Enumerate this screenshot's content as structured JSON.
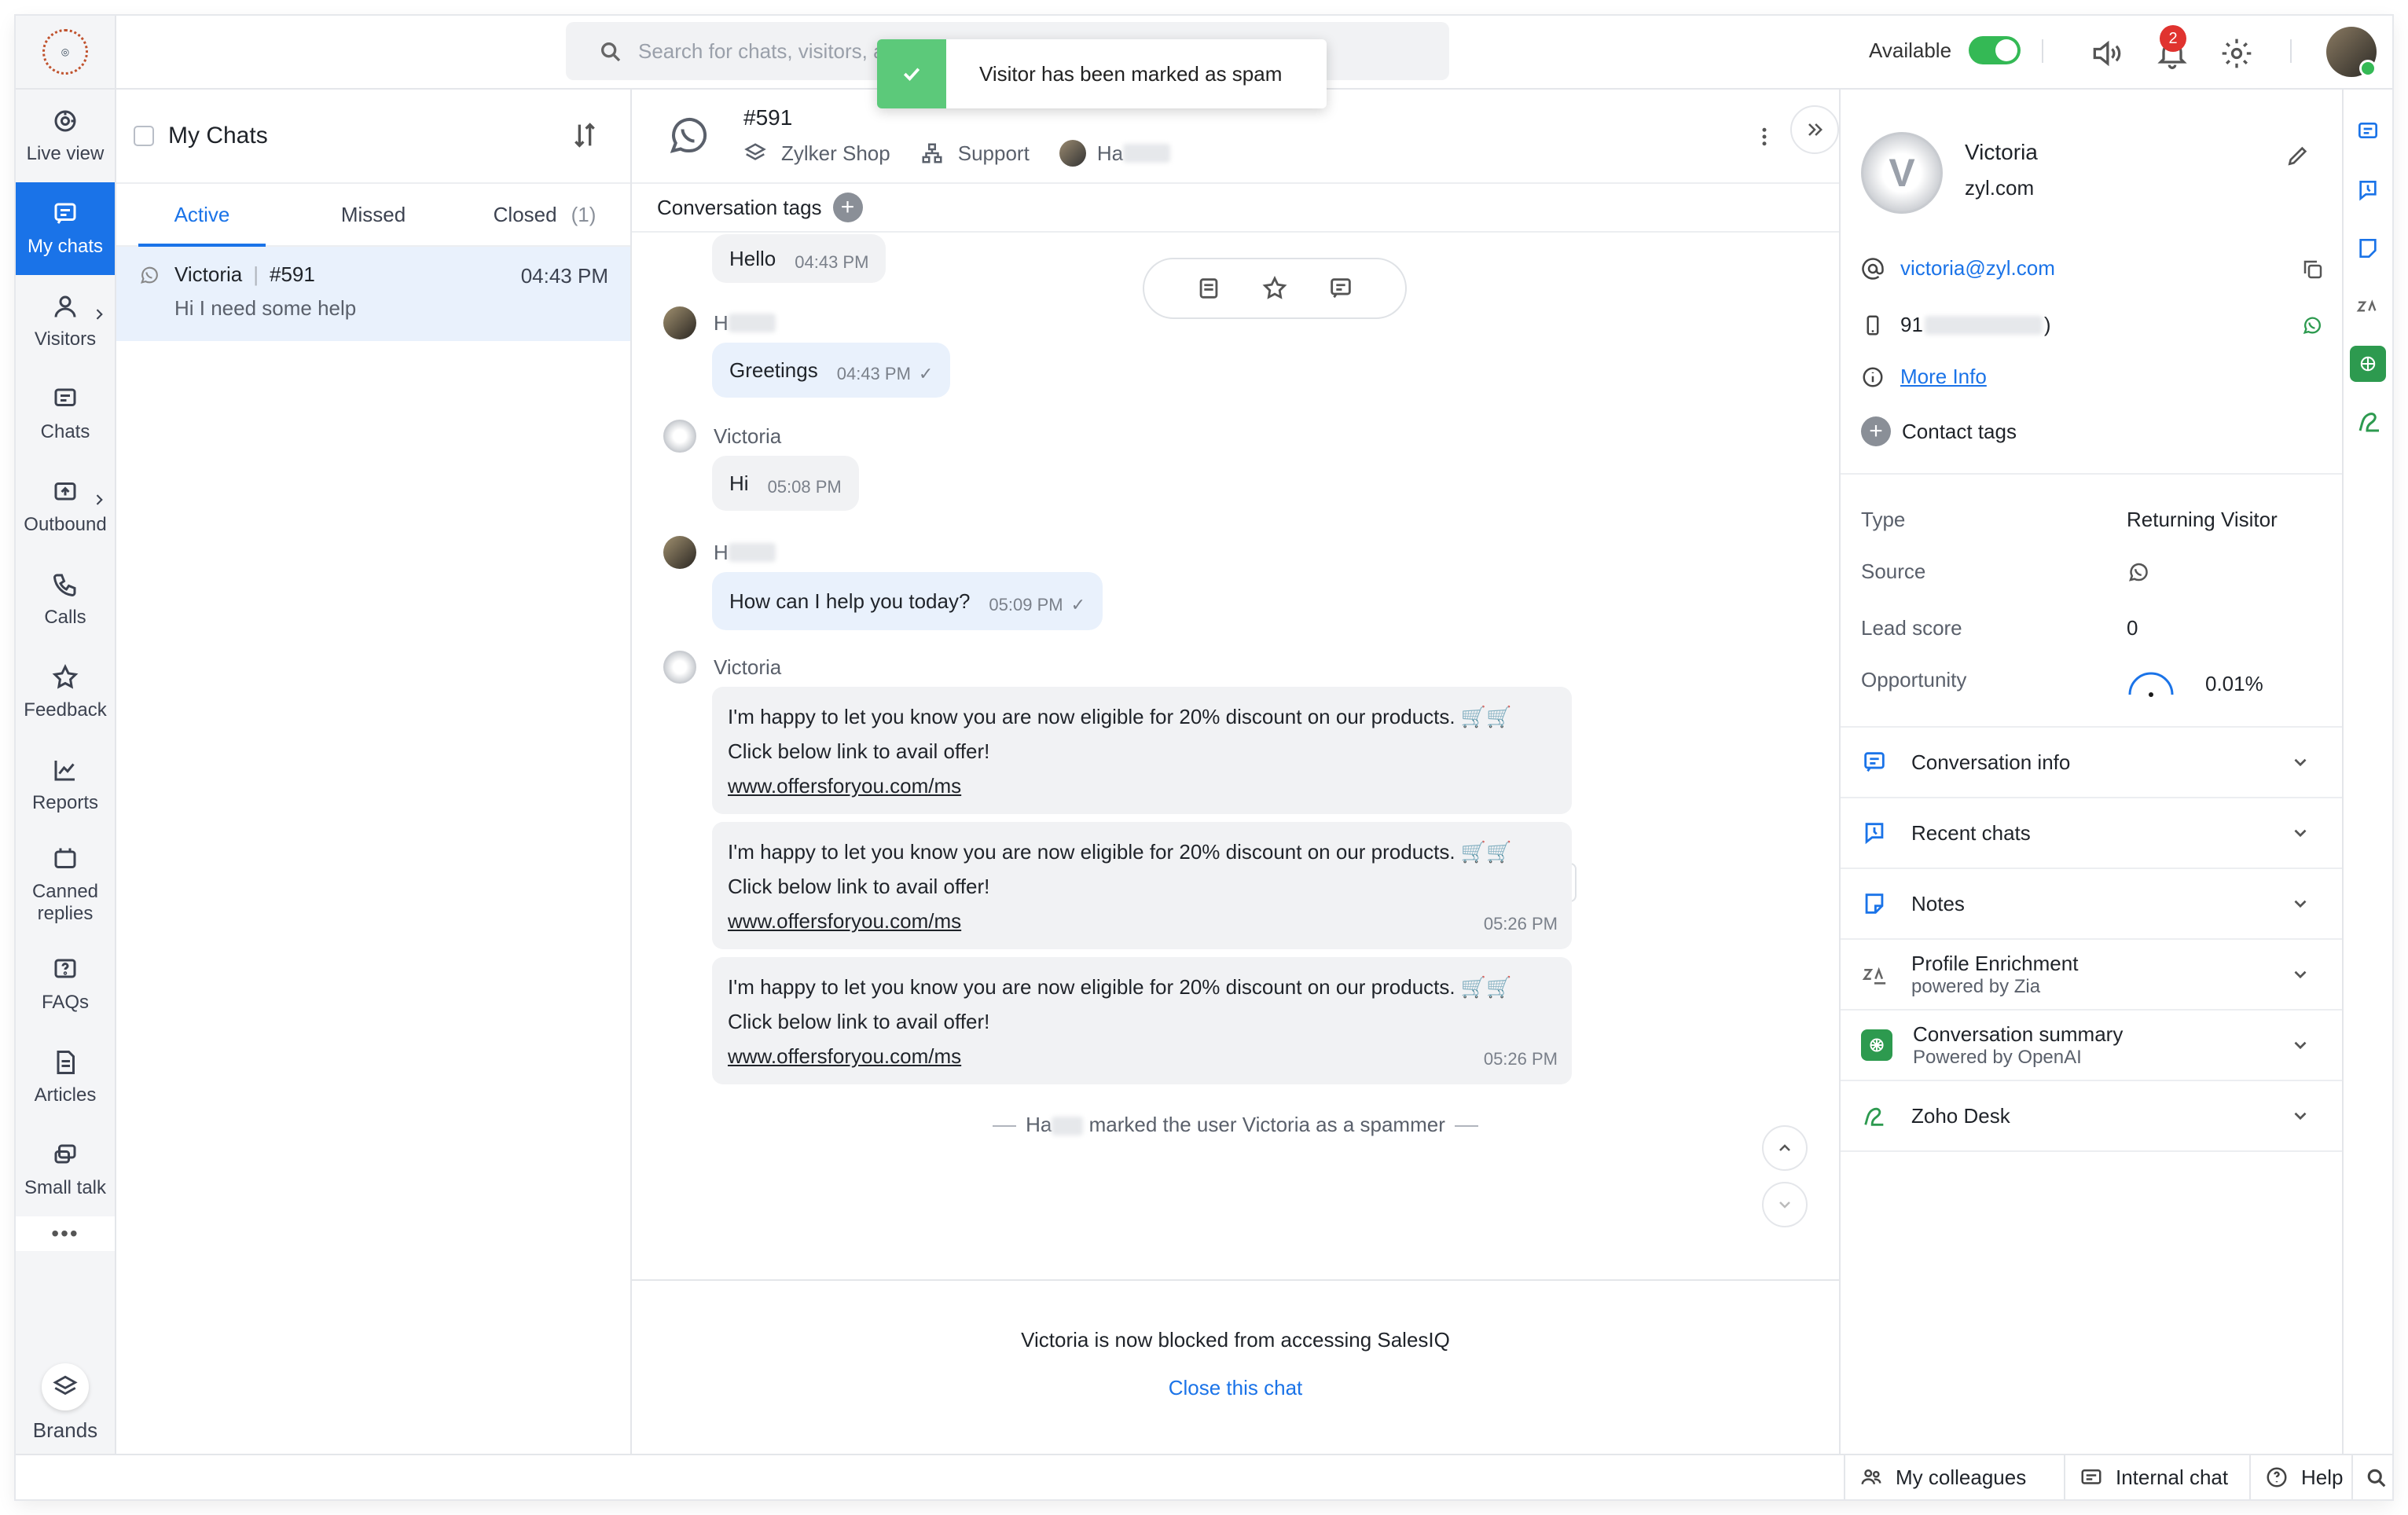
{
  "nav": {
    "items": [
      {
        "label": "Live view",
        "icon": "live-view-icon"
      },
      {
        "label": "My chats",
        "icon": "my-chats-icon"
      },
      {
        "label": "Visitors",
        "icon": "visitors-icon"
      },
      {
        "label": "Chats",
        "icon": "chats-icon"
      },
      {
        "label": "Outbound",
        "icon": "outbound-icon"
      },
      {
        "label": "Calls",
        "icon": "calls-icon"
      },
      {
        "label": "Feedback",
        "icon": "feedback-icon"
      },
      {
        "label": "Reports",
        "icon": "reports-icon"
      },
      {
        "label": "Canned replies",
        "icon": "canned-replies-icon"
      },
      {
        "label": "FAQs",
        "icon": "faqs-icon"
      },
      {
        "label": "Articles",
        "icon": "articles-icon"
      },
      {
        "label": "Small talk",
        "icon": "small-talk-icon"
      }
    ],
    "more": "•••",
    "brands": "Brands"
  },
  "topbar": {
    "search_placeholder": "Search for chats, visitors, and more",
    "status": "Available",
    "notifications": "2"
  },
  "toast": {
    "message": "Visitor has been marked as spam"
  },
  "chatlist": {
    "title": "My Chats",
    "tabs": {
      "active": "Active",
      "missed": "Missed",
      "closed": "Closed",
      "closed_count": "(1)"
    },
    "chat": {
      "name": "Victoria",
      "id": "#591",
      "time": "04:43 PM",
      "preview": "Hi I need some help"
    }
  },
  "conversation": {
    "id": "#591",
    "brand": "Zylker Shop",
    "department": "Support",
    "agent_prefix": "Ha",
    "tags_label": "Conversation tags",
    "messages": [
      {
        "text": "Hello",
        "time": "04:43 PM"
      },
      {
        "sender": "H",
        "text": "Greetings",
        "time": "04:43 PM"
      },
      {
        "sender": "Victoria",
        "text": "Hi",
        "time": "05:08 PM"
      },
      {
        "sender": "H",
        "text": "How can I help you today?",
        "time": "05:09 PM"
      },
      {
        "sender": "Victoria"
      }
    ],
    "promo": {
      "line1": "I'm happy to let you know you are now eligible for 20% discount on our products. 🛒🛒",
      "line2": "Click below link to avail offer!",
      "link": "www.offersforyou.com/ms",
      "time": "05:26 PM"
    },
    "system": {
      "agent": "Ha",
      "text": "marked the user Victoria as a spammer"
    },
    "footer": {
      "blocked": "Victoria is now blocked from accessing SalesIQ",
      "close": "Close this chat"
    }
  },
  "profile": {
    "name": "Victoria",
    "domain": "zyl.com",
    "email": "victoria@zyl.com",
    "phone_prefix": "91",
    "phone_suffix": ")",
    "more_info": "More Info",
    "contact_tags": "Contact tags",
    "details": [
      {
        "key": "Type",
        "value": "Returning Visitor"
      },
      {
        "key": "Source",
        "value": ""
      },
      {
        "key": "Lead score",
        "value": "0"
      },
      {
        "key": "Opportunity",
        "value": "0.01%"
      }
    ],
    "sections": [
      {
        "title": "Conversation info"
      },
      {
        "title": "Recent chats"
      },
      {
        "title": "Notes"
      },
      {
        "title": "Profile Enrichment",
        "sub": "powered by Zia"
      },
      {
        "title": "Conversation summary",
        "sub": "Powered by OpenAI"
      },
      {
        "title": "Zoho Desk"
      }
    ]
  },
  "footer": {
    "colleagues": "My colleagues",
    "internal": "Internal chat",
    "help": "Help"
  },
  "colors": {
    "accent": "#1a73e8",
    "available": "#34b955",
    "toast": "#5cc97a",
    "openai": "#2d9a4f",
    "badge": "#e0332f"
  }
}
